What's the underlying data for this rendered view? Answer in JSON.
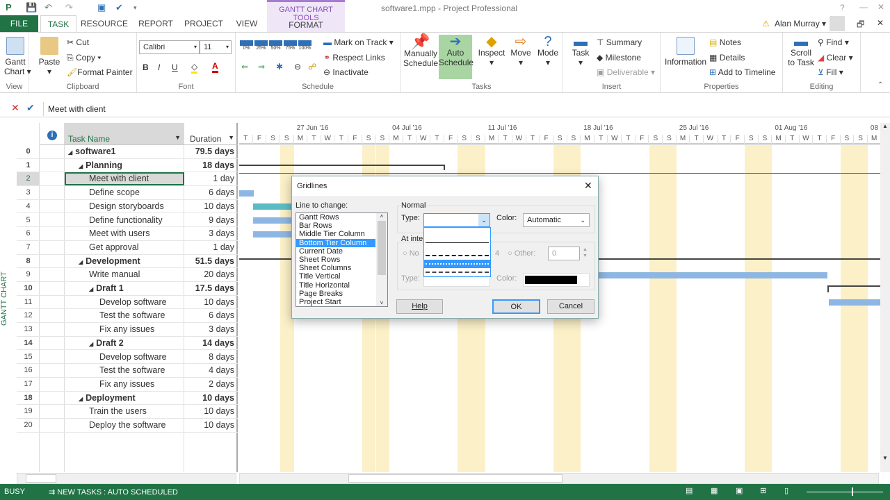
{
  "window": {
    "title": "software1.mpp - Project Professional",
    "help": "?",
    "minimize": "—",
    "restore": "🗗",
    "close": "✕"
  },
  "context_tab": {
    "group": "GANTT CHART TOOLS",
    "tab": "FORMAT",
    "color": "#a77bcf"
  },
  "tabs": [
    "FILE",
    "TASK",
    "RESOURCE",
    "REPORT",
    "PROJECT",
    "VIEW"
  ],
  "user": {
    "name": "Alan Murray ▾"
  },
  "ribbon": {
    "view": {
      "gantt": "Gantt",
      "chart": "Chart ▾",
      "label": "View"
    },
    "clipboard": {
      "paste": "Paste",
      "cut": "Cut",
      "copy": "Copy ▾",
      "painter": "Format Painter",
      "label": "Clipboard"
    },
    "font": {
      "name": "Calibri",
      "size": "11",
      "bold": "B",
      "italic": "I",
      "underline": "U",
      "label": "Font"
    },
    "schedule": {
      "pct": [
        "0%",
        "25%",
        "50%",
        "75%",
        "100%"
      ],
      "mark": "Mark on Track ▾",
      "respect": "Respect Links",
      "inactivate": "Inactivate",
      "label": "Schedule"
    },
    "tasks": {
      "manual1": "Manually",
      "manual2": "Schedule",
      "auto1": "Auto",
      "auto2": "Schedule",
      "inspect": "Inspect",
      "move": "Move",
      "mode": "Mode",
      "label": "Tasks"
    },
    "insert": {
      "task": "Task",
      "summary": "Summary",
      "milestone": "Milestone",
      "deliverable": "Deliverable ▾",
      "label": "Insert"
    },
    "properties": {
      "information": "Information",
      "notes": "Notes",
      "details": "Details",
      "timeline": "Add to Timeline",
      "label": "Properties"
    },
    "editing": {
      "scroll1": "Scroll",
      "scroll2": "to Task",
      "find": "Find ▾",
      "clear": "Clear ▾",
      "fill": "Fill ▾",
      "label": "Editing"
    }
  },
  "formula_bar": {
    "cancel": "✕",
    "accept": "✔",
    "value": "Meet with client"
  },
  "side_label": "GANTT CHART",
  "sheet": {
    "headers": {
      "info": "i",
      "task_name": "Task Name",
      "duration": "Duration"
    },
    "rows": [
      {
        "id": "0",
        "name": "software1",
        "duration": "79.5 days",
        "level": 0,
        "summary": true
      },
      {
        "id": "1",
        "name": "Planning",
        "duration": "18 days",
        "level": 1,
        "summary": true
      },
      {
        "id": "2",
        "name": "Meet with client",
        "duration": "1 day",
        "level": 2,
        "summary": false
      },
      {
        "id": "3",
        "name": "Define scope",
        "duration": "6 days",
        "level": 2,
        "summary": false
      },
      {
        "id": "4",
        "name": "Design storyboards",
        "duration": "10 days",
        "level": 2,
        "summary": false
      },
      {
        "id": "5",
        "name": "Define functionality",
        "duration": "9 days",
        "level": 2,
        "summary": false
      },
      {
        "id": "6",
        "name": "Meet with users",
        "duration": "3 days",
        "level": 2,
        "summary": false
      },
      {
        "id": "7",
        "name": "Get approval",
        "duration": "1 day",
        "level": 2,
        "summary": false
      },
      {
        "id": "8",
        "name": "Development",
        "duration": "51.5 days",
        "level": 1,
        "summary": true
      },
      {
        "id": "9",
        "name": "Write manual",
        "duration": "20 days",
        "level": 2,
        "summary": false
      },
      {
        "id": "10",
        "name": "Draft 1",
        "duration": "17.5 days",
        "level": 2,
        "summary": true
      },
      {
        "id": "11",
        "name": "Develop software",
        "duration": "10 days",
        "level": 3,
        "summary": false
      },
      {
        "id": "12",
        "name": "Test the software",
        "duration": "6 days",
        "level": 3,
        "summary": false
      },
      {
        "id": "13",
        "name": "Fix any issues",
        "duration": "3 days",
        "level": 3,
        "summary": false
      },
      {
        "id": "14",
        "name": "Draft 2",
        "duration": "14 days",
        "level": 2,
        "summary": true
      },
      {
        "id": "15",
        "name": "Develop software",
        "duration": "8 days",
        "level": 3,
        "summary": false
      },
      {
        "id": "16",
        "name": "Test the software",
        "duration": "4 days",
        "level": 3,
        "summary": false
      },
      {
        "id": "17",
        "name": "Fix any issues",
        "duration": "2 days",
        "level": 3,
        "summary": false
      },
      {
        "id": "18",
        "name": "Deployment",
        "duration": "10 days",
        "level": 1,
        "summary": true
      },
      {
        "id": "19",
        "name": "Train the users",
        "duration": "10 days",
        "level": 2,
        "summary": false
      },
      {
        "id": "20",
        "name": "Deploy the software",
        "duration": "10 days",
        "level": 2,
        "summary": false
      }
    ]
  },
  "timescale": {
    "weeks": [
      "27 Jun '16",
      "04 Jul '16",
      "11 Jul '16",
      "18 Jul '16",
      "25 Jul '16",
      "01 Aug '16",
      "08"
    ],
    "days": "TFSSMTWTFSSMTWTFSSMTWTFSSMTWTFSSMTWTFSSMTWTFSSM"
  },
  "colors": {
    "accent": "#217346",
    "bar": "#8db6e2",
    "weekend": "#fbf0c8",
    "selection": "#3399ff"
  },
  "dialog": {
    "title": "Gridlines",
    "close": "✕",
    "line_label": "Line to change:",
    "lines": [
      "Gantt Rows",
      "Bar Rows",
      "Middle Tier Column",
      "Bottom Tier Column",
      "Current Date",
      "Sheet Rows",
      "Sheet Columns",
      "Title Vertical",
      "Title Horizontal",
      "Page Breaks",
      "Project Start"
    ],
    "selected_line": "Bottom Tier Column",
    "normal_label": "Normal",
    "type_label": "Type:",
    "type_value": "",
    "color_label": "Color:",
    "color_value": "Automatic",
    "type_options": [
      "none",
      "solid",
      "long dash",
      "dotted",
      "dash dot"
    ],
    "highlighted_option": "dotted",
    "interval_label": "At inte",
    "none_label": "No",
    "four": "4",
    "other_label": "Other:",
    "other_value": "0",
    "interval_type_label": "Type:",
    "interval_color_label": "Color:",
    "interval_color": "#000000",
    "help": "Help",
    "ok": "OK",
    "cancel": "Cancel"
  },
  "status": {
    "mode": "BUSY",
    "new_tasks": "NEW TASKS : AUTO SCHEDULED"
  }
}
